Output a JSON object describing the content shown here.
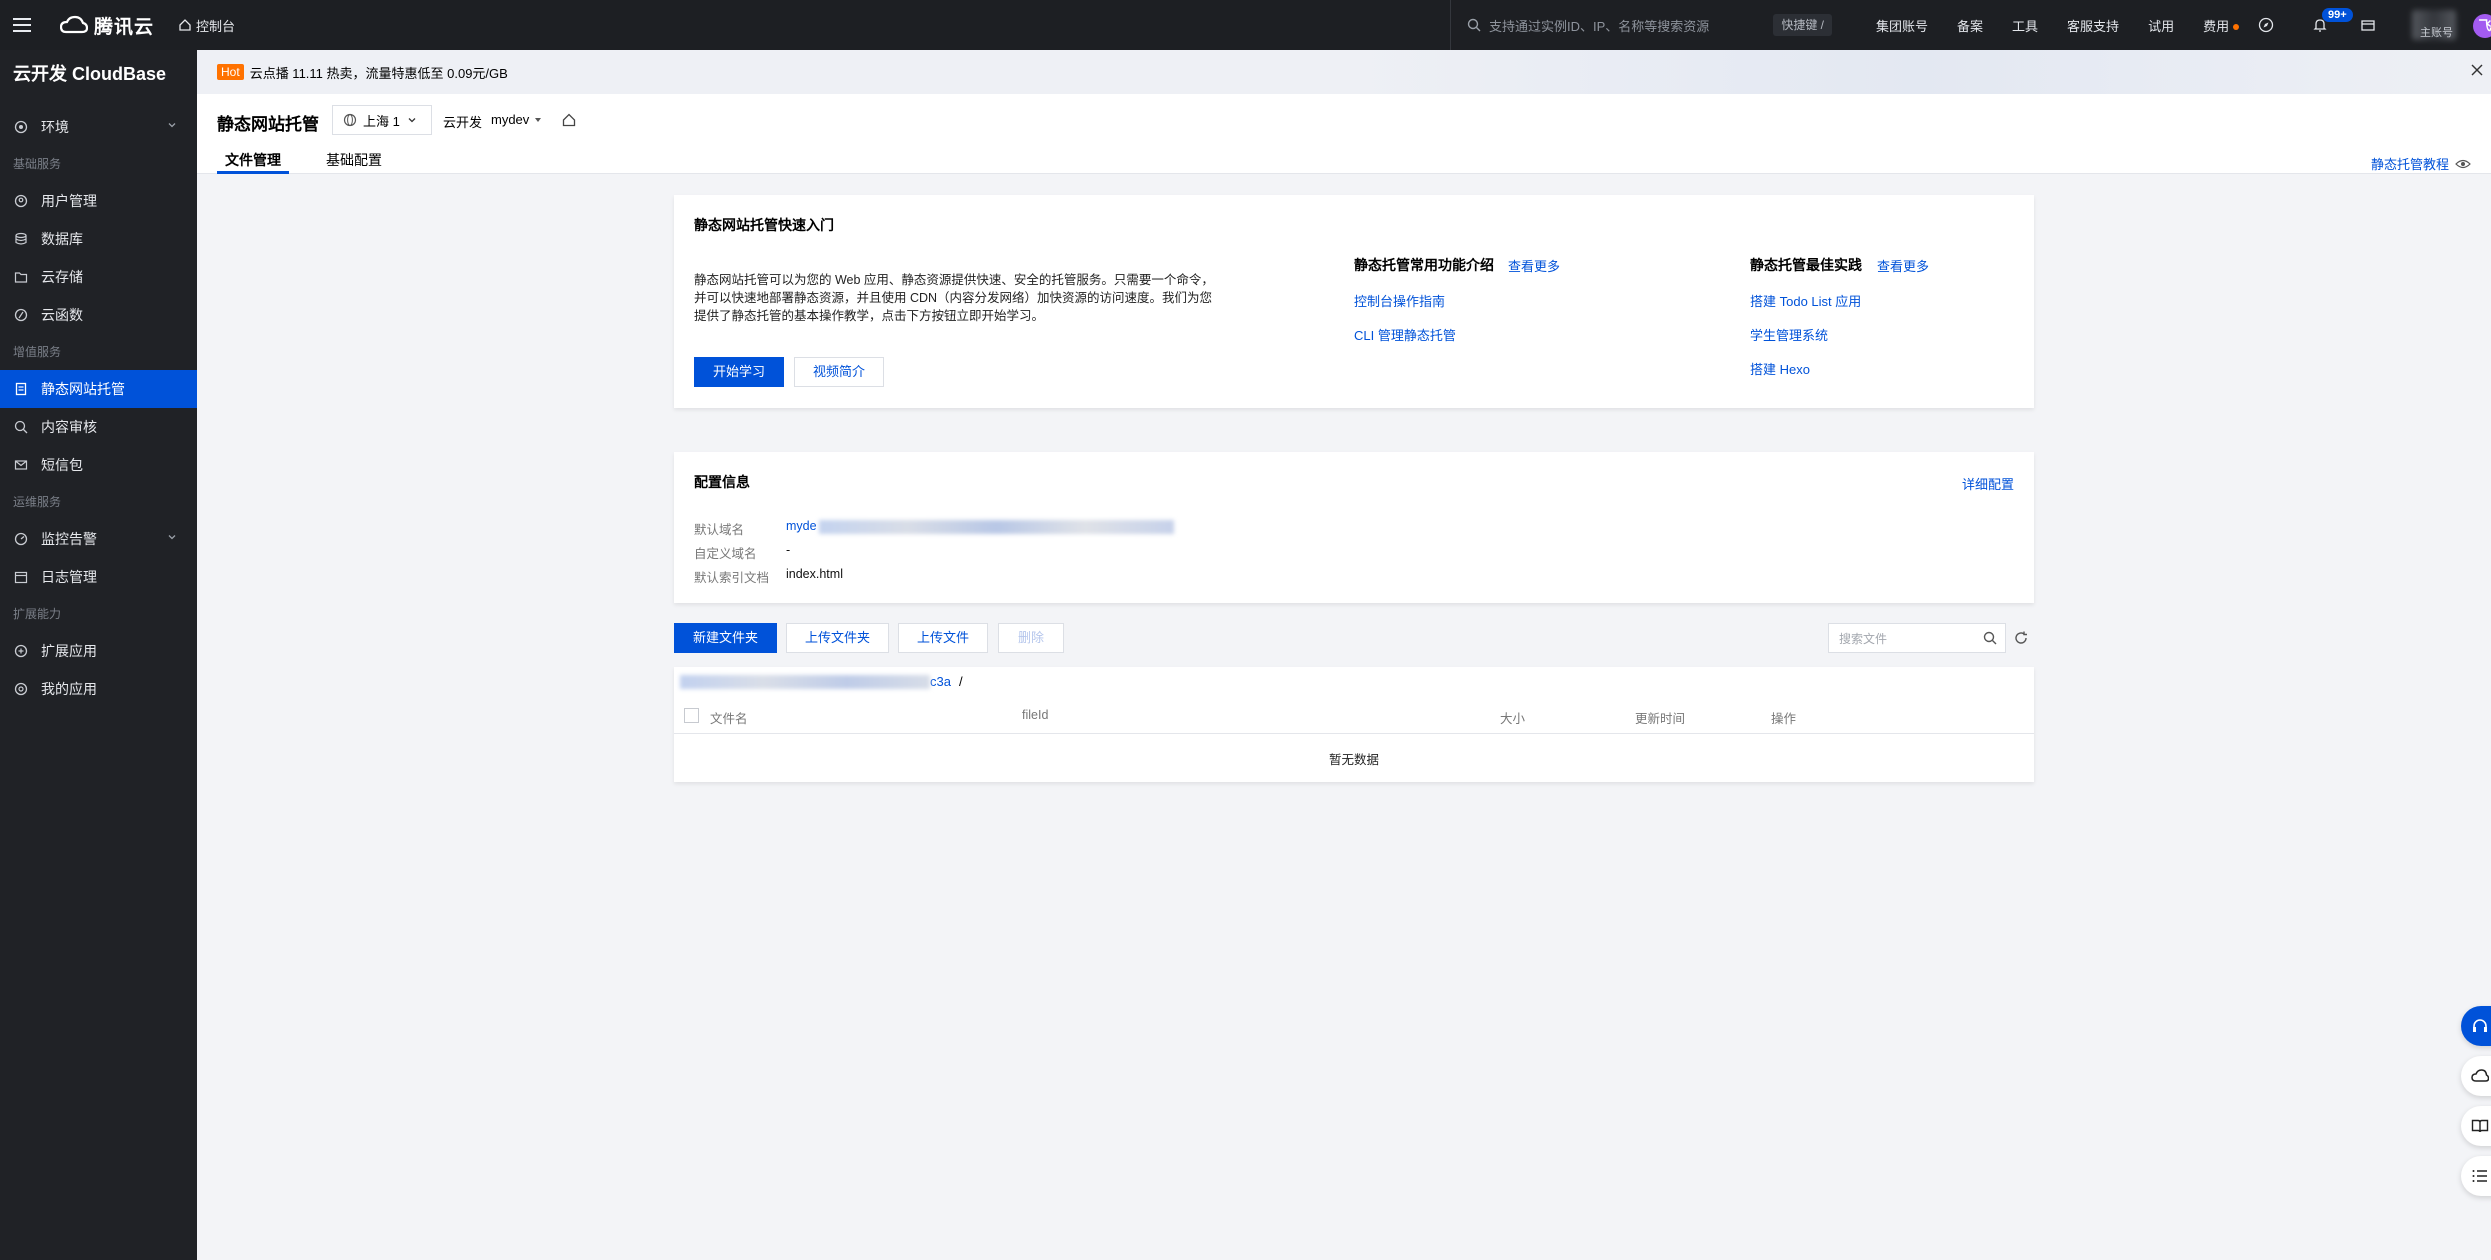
{
  "topbar": {
    "brand": "腾讯云",
    "console": "控制台",
    "search_placeholder": "支持通过实例ID、IP、名称等搜索资源",
    "shortcut": "快捷键 /",
    "links": [
      "集团账号",
      "备案",
      "工具",
      "客服支持",
      "试用",
      "费用"
    ],
    "notification_count": "99+",
    "user_subtitle": "主账号",
    "avatar_letter": "飞"
  },
  "sidebar": {
    "title": "云开发 CloudBase",
    "env_item": "环境",
    "groups": {
      "basic": "基础服务",
      "value_added": "增值服务",
      "ops": "运维服务",
      "extend": "扩展能力"
    },
    "items": {
      "users": "用户管理",
      "database": "数据库",
      "storage": "云存储",
      "functions": "云函数",
      "hosting": "静态网站托管",
      "audit": "内容审核",
      "sms": "短信包",
      "monitor": "监控告警",
      "logs": "日志管理",
      "ext_apps": "扩展应用",
      "my_apps": "我的应用"
    }
  },
  "announce": {
    "hot": "Hot",
    "text": "云点播 11.11 热卖，流量特惠低至 0.09元/GB"
  },
  "page": {
    "title": "静态网站托管",
    "region": "上海 1",
    "env_label": "云开发",
    "env_value": "mydev",
    "tabs": [
      "文件管理",
      "基础配置"
    ],
    "tutorial": "静态托管教程"
  },
  "quickstart": {
    "title": "静态网站托管快速入门",
    "intro": "静态网站托管可以为您的 Web 应用、静态资源提供快速、安全的托管服务。只需要一个命令，并可以快速地部署静态资源，并且使用 CDN（内容分发网络）加快资源的访问速度。我们为您提供了静态托管的基本操作教学，点击下方按钮立即开始学习。",
    "btn_learn": "开始学习",
    "btn_video": "视频简介",
    "features_title": "静态托管常用功能介绍",
    "features_more": "查看更多",
    "features": [
      "控制台操作指南",
      "CLI 管理静态托管"
    ],
    "best_title": "静态托管最佳实践",
    "best_more": "查看更多",
    "best": [
      "搭建 Todo List 应用",
      "学生管理系统",
      "搭建 Hexo"
    ]
  },
  "config": {
    "title": "配置信息",
    "detail": "详细配置",
    "default_domain_label": "默认域名",
    "default_domain_value": "myde",
    "custom_domain_label": "自定义域名",
    "custom_domain_value": "-",
    "index_label": "默认索引文档",
    "index_value": "index.html"
  },
  "toolbar": {
    "new_folder": "新建文件夹",
    "upload_folder": "上传文件夹",
    "upload_file": "上传文件",
    "delete": "删除",
    "search_placeholder": "搜索文件"
  },
  "files": {
    "path_tail": "c3a",
    "path_sep": "/",
    "columns": [
      "文件名",
      "fileId",
      "大小",
      "更新时间",
      "操作"
    ],
    "empty": "暂无数据"
  },
  "colors": {
    "brand": "#0052d9",
    "hot": "#ff7200",
    "sidebar_bg": "#202226",
    "topbar_bg": "#1d1f23"
  }
}
